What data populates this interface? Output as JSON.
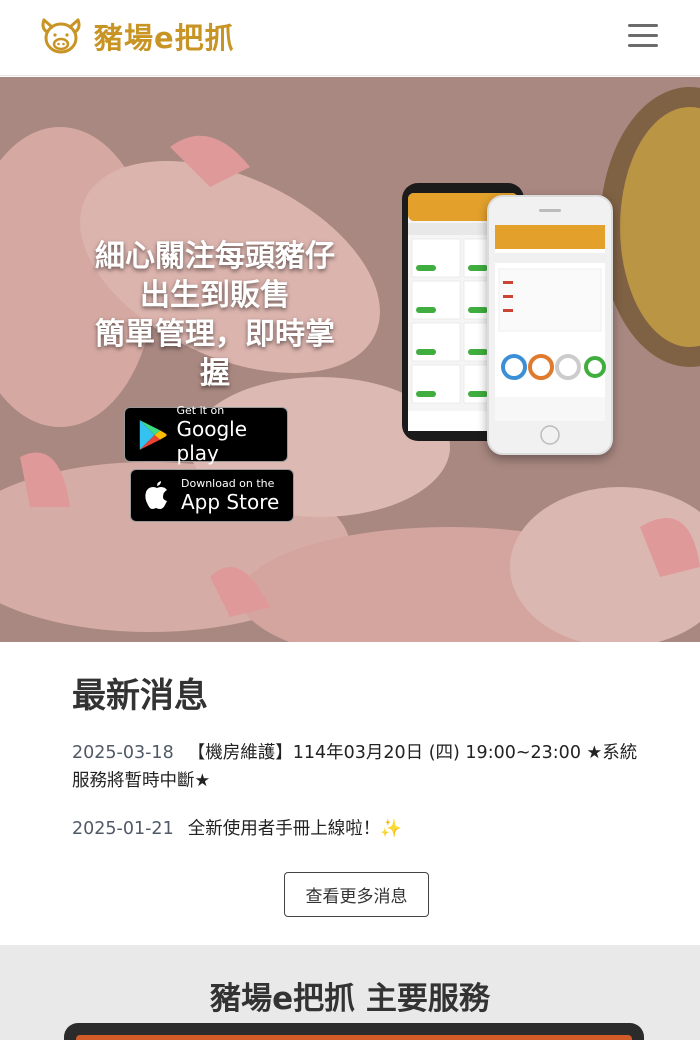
{
  "header": {
    "brand_name": "豬場e把抓",
    "logo_icon": "pig-logo-icon",
    "menu_icon": "hamburger-menu-icon",
    "brand_color": "#c89424"
  },
  "hero": {
    "headline_lines": [
      "細心關注每頭豬仔",
      "出生到販售",
      "簡單管理，即時掌",
      "握"
    ],
    "google_play": {
      "small": "Get it on",
      "big": "Google play"
    },
    "app_store": {
      "small": "Download on the",
      "big": "App Store"
    }
  },
  "news": {
    "title": "最新消息",
    "items": [
      {
        "date": "2025-03-18",
        "text": "【機房維護】114年03月20日 (四) 19:00~23:00 ★系統服務將暫時中斷★"
      },
      {
        "date": "2025-01-21",
        "text": "全新使用者手冊上線啦！✨"
      }
    ],
    "more_label": "查看更多消息"
  },
  "services": {
    "title": "豬場e把抓 主要服務"
  }
}
